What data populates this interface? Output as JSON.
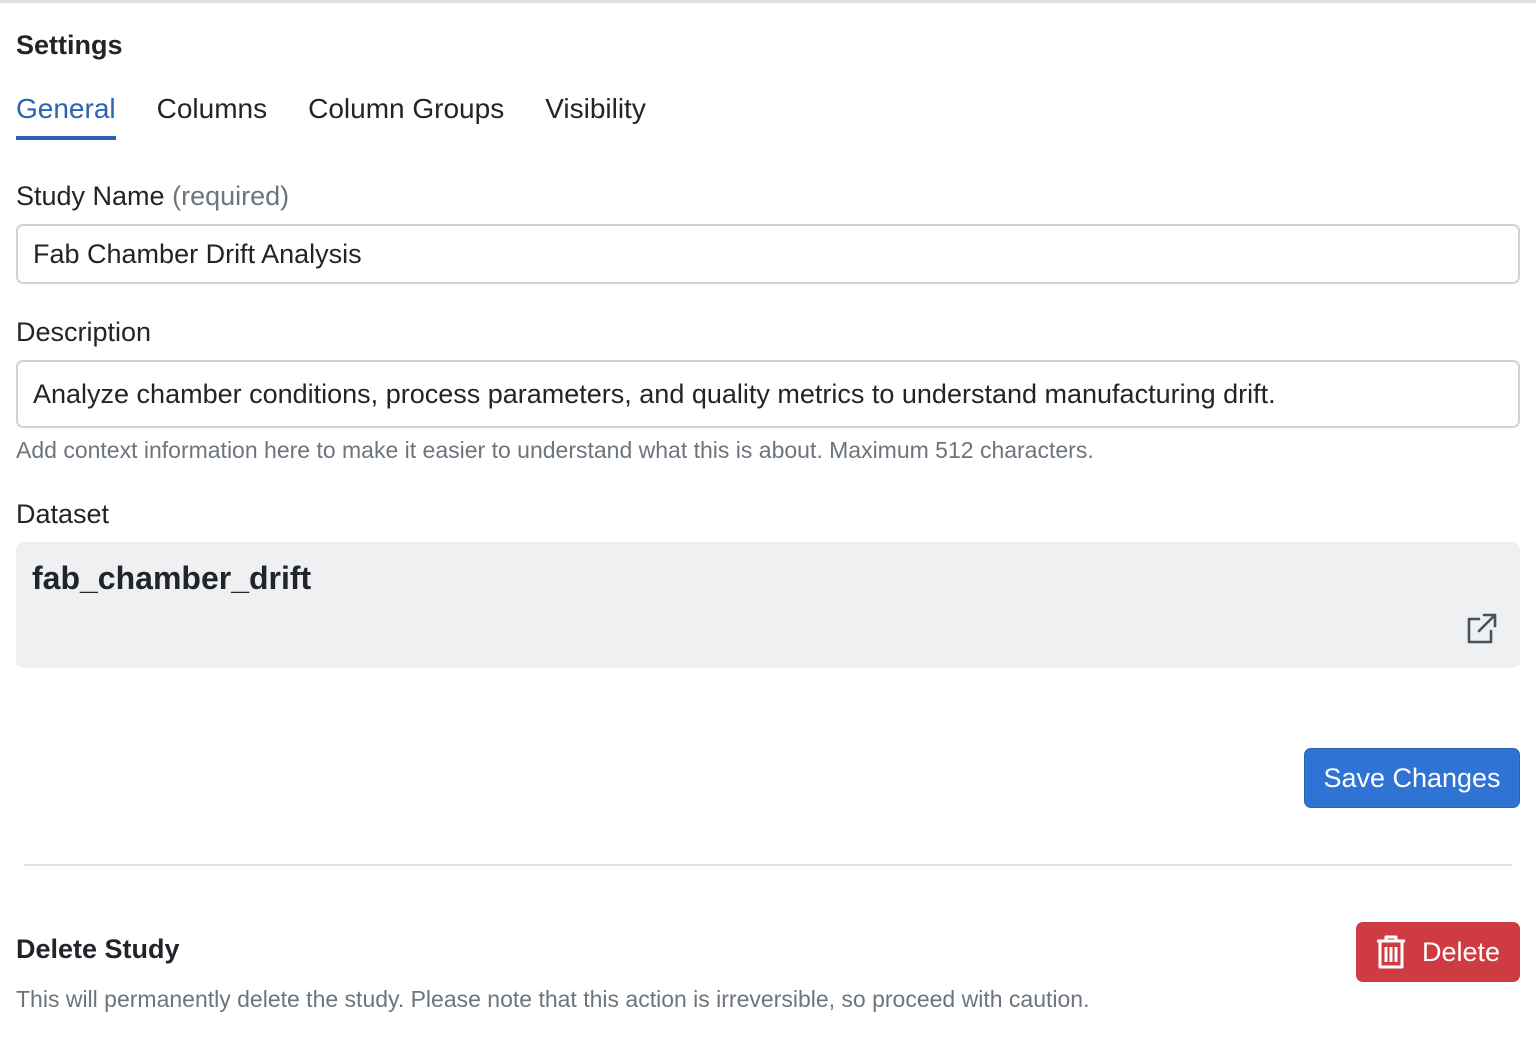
{
  "page": {
    "title": "Settings"
  },
  "tabs": [
    {
      "label": "General",
      "active": true
    },
    {
      "label": "Columns",
      "active": false
    },
    {
      "label": "Column Groups",
      "active": false
    },
    {
      "label": "Visibility",
      "active": false
    }
  ],
  "study_name": {
    "label": "Study Name",
    "required_hint": "(required)",
    "value": "Fab Chamber Drift Analysis"
  },
  "description": {
    "label": "Description",
    "value": "Analyze chamber conditions, process parameters, and quality metrics to understand manufacturing drift.",
    "help": "Add context information here to make it easier to understand what this is about. Maximum 512 characters."
  },
  "dataset": {
    "label": "Dataset",
    "name": "fab_chamber_drift",
    "link_icon": "external-link-icon"
  },
  "actions": {
    "save_label": "Save Changes"
  },
  "danger_zone": {
    "title": "Delete Study",
    "text": "This will permanently delete the study. Please note that this action is irreversible, so proceed with caution.",
    "delete_label": "Delete",
    "delete_icon": "trash-icon"
  },
  "colors": {
    "accent": "#2b63b0",
    "primary_button": "#2f73d4",
    "danger_button": "#cf3b43",
    "dataset_background": "#eef0f2",
    "muted_text": "#6c757d"
  }
}
